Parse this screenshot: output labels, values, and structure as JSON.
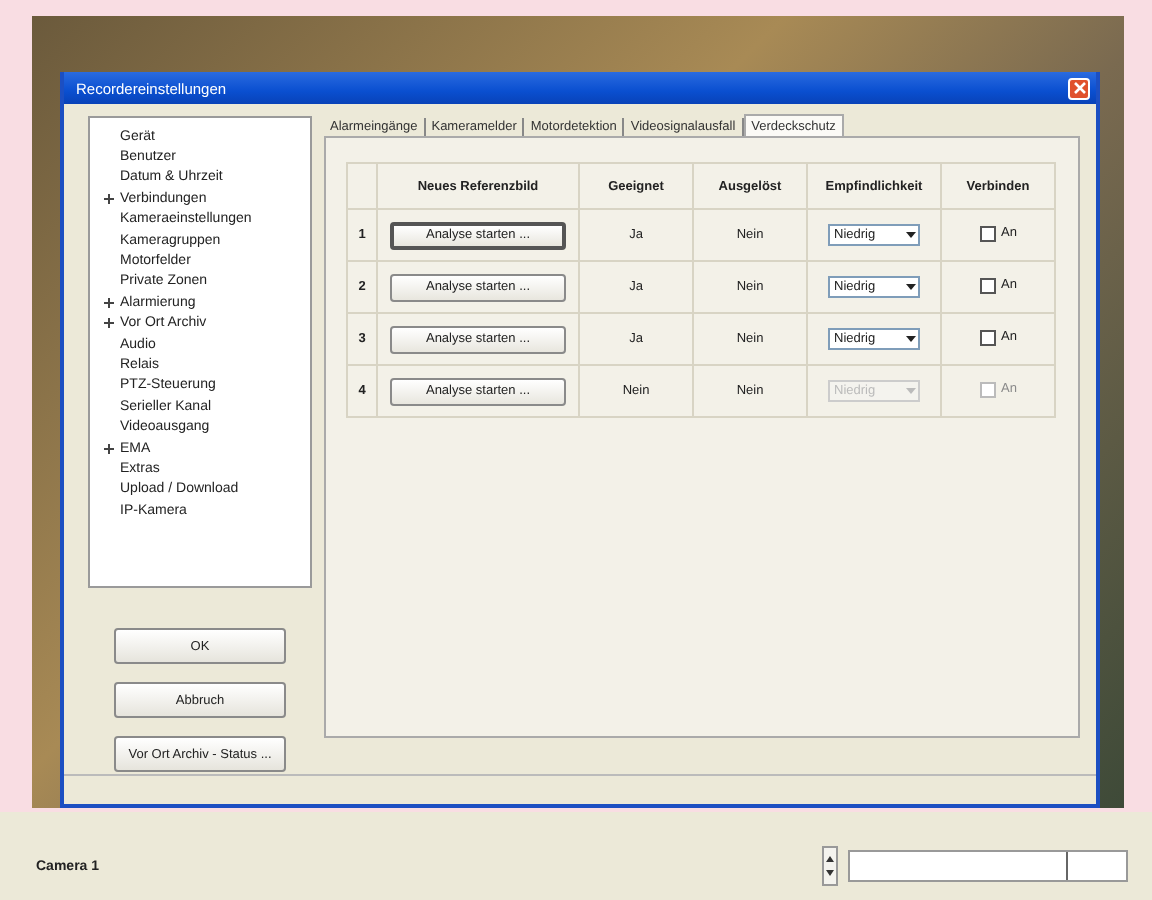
{
  "dialog": {
    "title": "Recordereinstellungen"
  },
  "tree": [
    {
      "label": "Gerät",
      "selected": false
    },
    {
      "label": "Benutzer",
      "selected": false
    },
    {
      "label": "Datum & Uhrzeit",
      "selected": false
    },
    {
      "label": "Verbindungen",
      "selected": false,
      "expanded": false
    },
    {
      "label": "Kameraeinstellungen",
      "selected": false
    },
    {
      "label": "Kameragruppen",
      "selected": false
    },
    {
      "label": "Motorfelder",
      "selected": false
    },
    {
      "label": "Private Zonen",
      "selected": false
    },
    {
      "label": "Alarmierung",
      "selected": false,
      "expanded": false
    },
    {
      "label": "Vor Ort Archiv",
      "selected": false,
      "expanded": false
    },
    {
      "label": "Audio",
      "selected": false
    },
    {
      "label": "Relais",
      "selected": false
    },
    {
      "label": "PTZ-Steuerung",
      "selected": false
    },
    {
      "label": "Serieller Kanal",
      "selected": false
    },
    {
      "label": "Videoausgang",
      "selected": false
    },
    {
      "label": "EMA",
      "selected": false,
      "expanded": false
    },
    {
      "label": "Extras",
      "selected": false
    },
    {
      "label": "Upload / Download",
      "selected": false
    },
    {
      "label": "IP-Kamera",
      "selected": false
    }
  ],
  "buttons": [
    "OK",
    "Abbruch",
    "Vor Ort Archiv - Status ..."
  ],
  "tabs": [
    {
      "label": "Alarmeingänge",
      "selected": false
    },
    {
      "label": "Kameramelder",
      "selected": false
    },
    {
      "label": "Motordetektion",
      "selected": false
    },
    {
      "label": "Videosignalausfall",
      "selected": false
    },
    {
      "label": "Verdeckschutz",
      "selected": true
    }
  ],
  "table": {
    "columns": [
      "Neues Referenzbild",
      "Geeignet",
      "Ausgelöst",
      "Empfindlichkeit",
      "Verbinden"
    ],
    "rows": [
      {
        "number": "1",
        "button": "Analyse starten ...",
        "focused": true,
        "suitable": "Ja",
        "triggered": "Nein",
        "sensitivity": "Niedrig",
        "connect_label": "An",
        "checked": false,
        "disabled": false
      },
      {
        "number": "2",
        "button": "Analyse starten ...",
        "focused": false,
        "suitable": "Ja",
        "triggered": "Nein",
        "sensitivity": "Niedrig",
        "connect_label": "An",
        "checked": false,
        "disabled": false
      },
      {
        "number": "3",
        "button": "Analyse starten ...",
        "focused": false,
        "suitable": "Ja",
        "triggered": "Nein",
        "sensitivity": "Niedrig",
        "connect_label": "An",
        "checked": false,
        "disabled": false
      },
      {
        "number": "4",
        "button": "Analyse starten ...",
        "focused": false,
        "suitable": "Nein",
        "triggered": "Nein",
        "sensitivity": "Niedrig",
        "connect_label": "An",
        "checked": false,
        "disabled": true
      }
    ]
  },
  "status_bar": {
    "camera": "Camera 1",
    "slider": {
      "level": 0.78
    }
  }
}
